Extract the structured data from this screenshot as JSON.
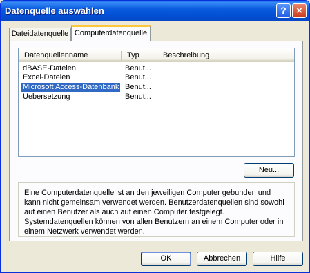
{
  "window": {
    "title": "Datenquelle auswählen",
    "help_button": "?",
    "close_button": "×"
  },
  "tabs": [
    {
      "label": "Dateidatenquelle",
      "active": false
    },
    {
      "label": "Computerdatenquelle",
      "active": true
    }
  ],
  "list": {
    "columns": [
      "Datenquellenname",
      "Typ",
      "Beschreibung"
    ],
    "rows": [
      {
        "name": "dBASE-Dateien",
        "type": "Benut...",
        "description": ""
      },
      {
        "name": "Excel-Dateien",
        "type": "Benut...",
        "description": ""
      },
      {
        "name": "Microsoft Access-Datenbank",
        "type": "Benut...",
        "description": "",
        "selected": true
      },
      {
        "name": "Uebersetzung",
        "type": "Benut...",
        "description": ""
      }
    ]
  },
  "buttons": {
    "new": "Neu...",
    "ok": "OK",
    "cancel": "Abbrechen",
    "help": "Hilfe"
  },
  "description": "Eine Computerdatenquelle ist an den jeweiligen Computer gebunden und kann nicht gemeinsam verwendet werden. Benutzerdatenquellen sind sowohl auf einen Benutzer als auch auf einen Computer festgelegt. Systemdatenquellen können von allen Benutzern an einem Computer oder in einem Netzwerk verwendet werden.",
  "colors": {
    "titlebar": "#0250d6",
    "selection": "#316ac5",
    "active_tab_accent": "#ffc83c",
    "dialog_background": "#ece9d8"
  }
}
